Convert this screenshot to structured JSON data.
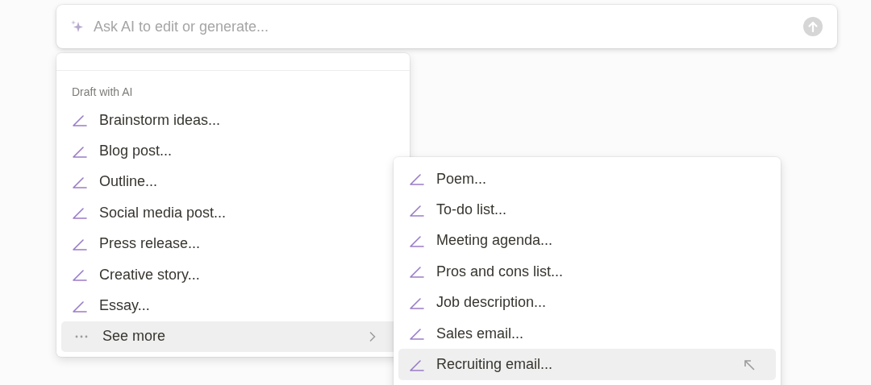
{
  "prompt": {
    "placeholder": "Ask AI to edit or generate..."
  },
  "menu": {
    "section": "Draft with AI",
    "items": [
      {
        "label": "Brainstorm ideas...",
        "kind": "draft",
        "selected": false
      },
      {
        "label": "Blog post...",
        "kind": "draft",
        "selected": false
      },
      {
        "label": "Outline...",
        "kind": "draft",
        "selected": false
      },
      {
        "label": "Social media post...",
        "kind": "draft",
        "selected": false
      },
      {
        "label": "Press release...",
        "kind": "draft",
        "selected": false
      },
      {
        "label": "Creative story...",
        "kind": "draft",
        "selected": false
      },
      {
        "label": "Essay...",
        "kind": "draft",
        "selected": false
      },
      {
        "label": "See more",
        "kind": "more",
        "selected": true
      }
    ]
  },
  "submenu": {
    "items": [
      {
        "label": "Poem...",
        "selected": false
      },
      {
        "label": "To-do list...",
        "selected": false
      },
      {
        "label": "Meeting agenda...",
        "selected": false
      },
      {
        "label": "Pros and cons list...",
        "selected": false
      },
      {
        "label": "Job description...",
        "selected": false
      },
      {
        "label": "Sales email...",
        "selected": false
      },
      {
        "label": "Recruiting email...",
        "selected": true
      }
    ]
  }
}
